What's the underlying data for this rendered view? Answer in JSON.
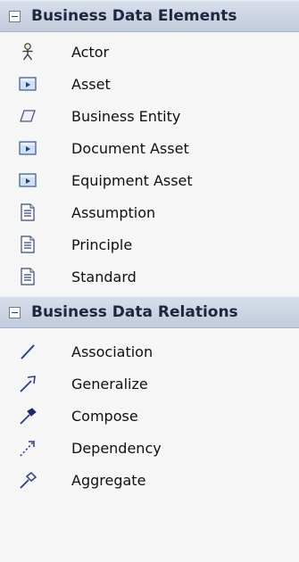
{
  "sections": [
    {
      "title": "Business Data Elements",
      "items": [
        {
          "label": "Actor",
          "icon": "actor-icon"
        },
        {
          "label": "Asset",
          "icon": "asset-icon"
        },
        {
          "label": "Business Entity",
          "icon": "business-entity-icon"
        },
        {
          "label": "Document Asset",
          "icon": "document-asset-icon"
        },
        {
          "label": "Equipment Asset",
          "icon": "equipment-asset-icon"
        },
        {
          "label": "Assumption",
          "icon": "document-page-icon"
        },
        {
          "label": "Principle",
          "icon": "document-page-icon"
        },
        {
          "label": "Standard",
          "icon": "document-page-icon"
        }
      ]
    },
    {
      "title": "Business Data Relations",
      "items": [
        {
          "label": "Association",
          "icon": "association-line-icon"
        },
        {
          "label": "Generalize",
          "icon": "generalize-arrow-icon"
        },
        {
          "label": "Compose",
          "icon": "compose-arrow-icon"
        },
        {
          "label": "Dependency",
          "icon": "dependency-arrow-icon"
        },
        {
          "label": "Aggregate",
          "icon": "aggregate-arrow-icon"
        }
      ]
    }
  ],
  "colors": {
    "header_bg": "#c8d0e0",
    "panel_bg": "#f6f6f6",
    "relation_line": "#2a3a9a"
  }
}
